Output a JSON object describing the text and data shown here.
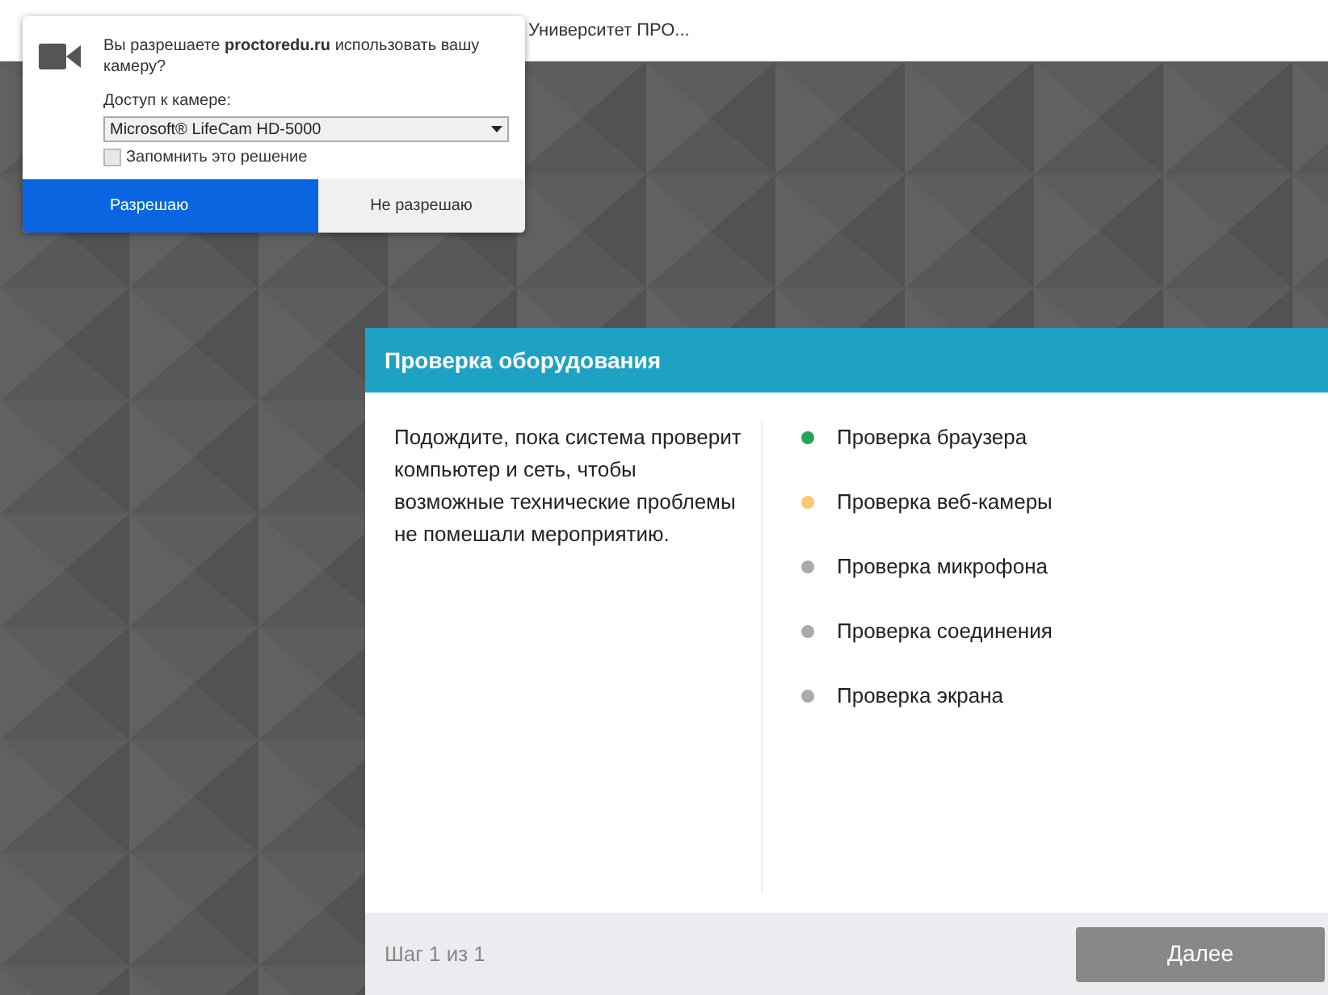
{
  "browser": {
    "tab_title": "Университет ПРО..."
  },
  "permission_popup": {
    "question": "Вы разрешаете **proctoredu.ru** использовать вашу камеру?",
    "access_label": "Доступ к камере:",
    "camera_select": {
      "value": "Microsoft® LifeCam HD-5000"
    },
    "remember": {
      "label": "Запомнить это решение",
      "checked": false
    },
    "buttons": [
      {
        "label": "Разрешаю",
        "selected": true
      },
      {
        "label": "Не разрешаю",
        "selected": false
      }
    ]
  },
  "dialog": {
    "title": "Проверка оборудования",
    "description": "Подождите, пока система проверит компьютер и сеть, чтобы возможные технические проблемы не помешали мероприятию.",
    "checks": [
      {
        "label": "Проверка браузера",
        "color": "#22a55a"
      },
      {
        "label": "Проверка веб-камеры",
        "color": "#f9c96b"
      },
      {
        "label": "Проверка микрофона",
        "color": "#aaaaaa"
      },
      {
        "label": "Проверка соединения",
        "color": "#aaaaaa"
      },
      {
        "label": "Проверка экрана",
        "color": "#aaaaaa"
      }
    ],
    "step": "Шаг 1 из 1",
    "next_button": {
      "label": "Далее",
      "disabled": true
    }
  }
}
